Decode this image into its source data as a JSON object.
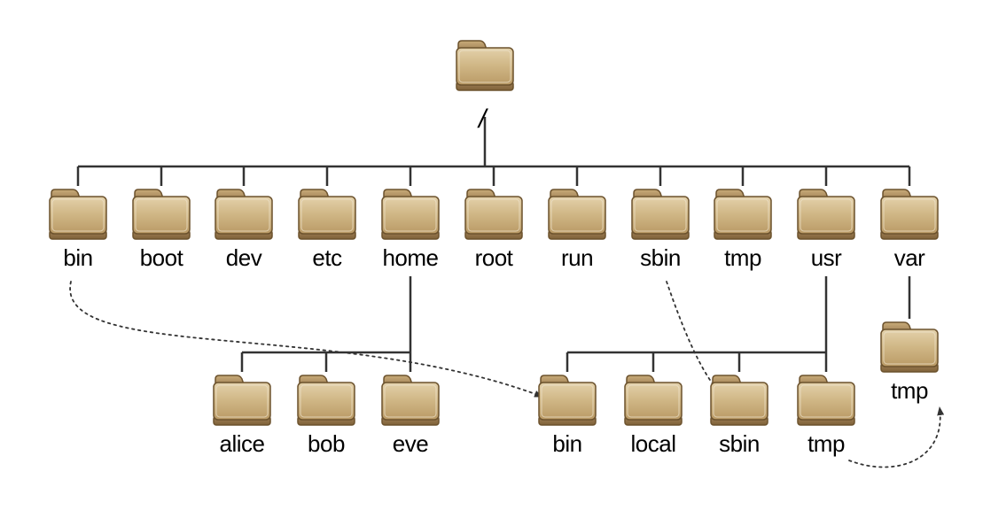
{
  "diagram": {
    "type": "filesystem-tree",
    "root_label": "/",
    "level1": [
      {
        "name": "bin"
      },
      {
        "name": "boot"
      },
      {
        "name": "dev"
      },
      {
        "name": "etc"
      },
      {
        "name": "home"
      },
      {
        "name": "root"
      },
      {
        "name": "run"
      },
      {
        "name": "sbin"
      },
      {
        "name": "tmp"
      },
      {
        "name": "usr"
      },
      {
        "name": "var"
      }
    ],
    "home_children": [
      {
        "name": "alice"
      },
      {
        "name": "bob"
      },
      {
        "name": "eve"
      }
    ],
    "usr_children": [
      {
        "name": "bin"
      },
      {
        "name": "local"
      },
      {
        "name": "sbin"
      },
      {
        "name": "tmp"
      }
    ],
    "var_children": [
      {
        "name": "tmp"
      }
    ],
    "dotted_links": [
      {
        "from": "/bin",
        "to": "/usr/bin"
      },
      {
        "from": "/sbin",
        "to": "/usr/sbin"
      },
      {
        "from": "/usr/tmp",
        "to": "/var/tmp"
      }
    ]
  },
  "colors": {
    "folder_light": "#d6bf95",
    "folder_dark": "#b99b6b",
    "folder_tab": "#ad8f5f",
    "folder_base": "#8c6b3f",
    "folder_outline": "#6c522d",
    "line": "#333333"
  }
}
